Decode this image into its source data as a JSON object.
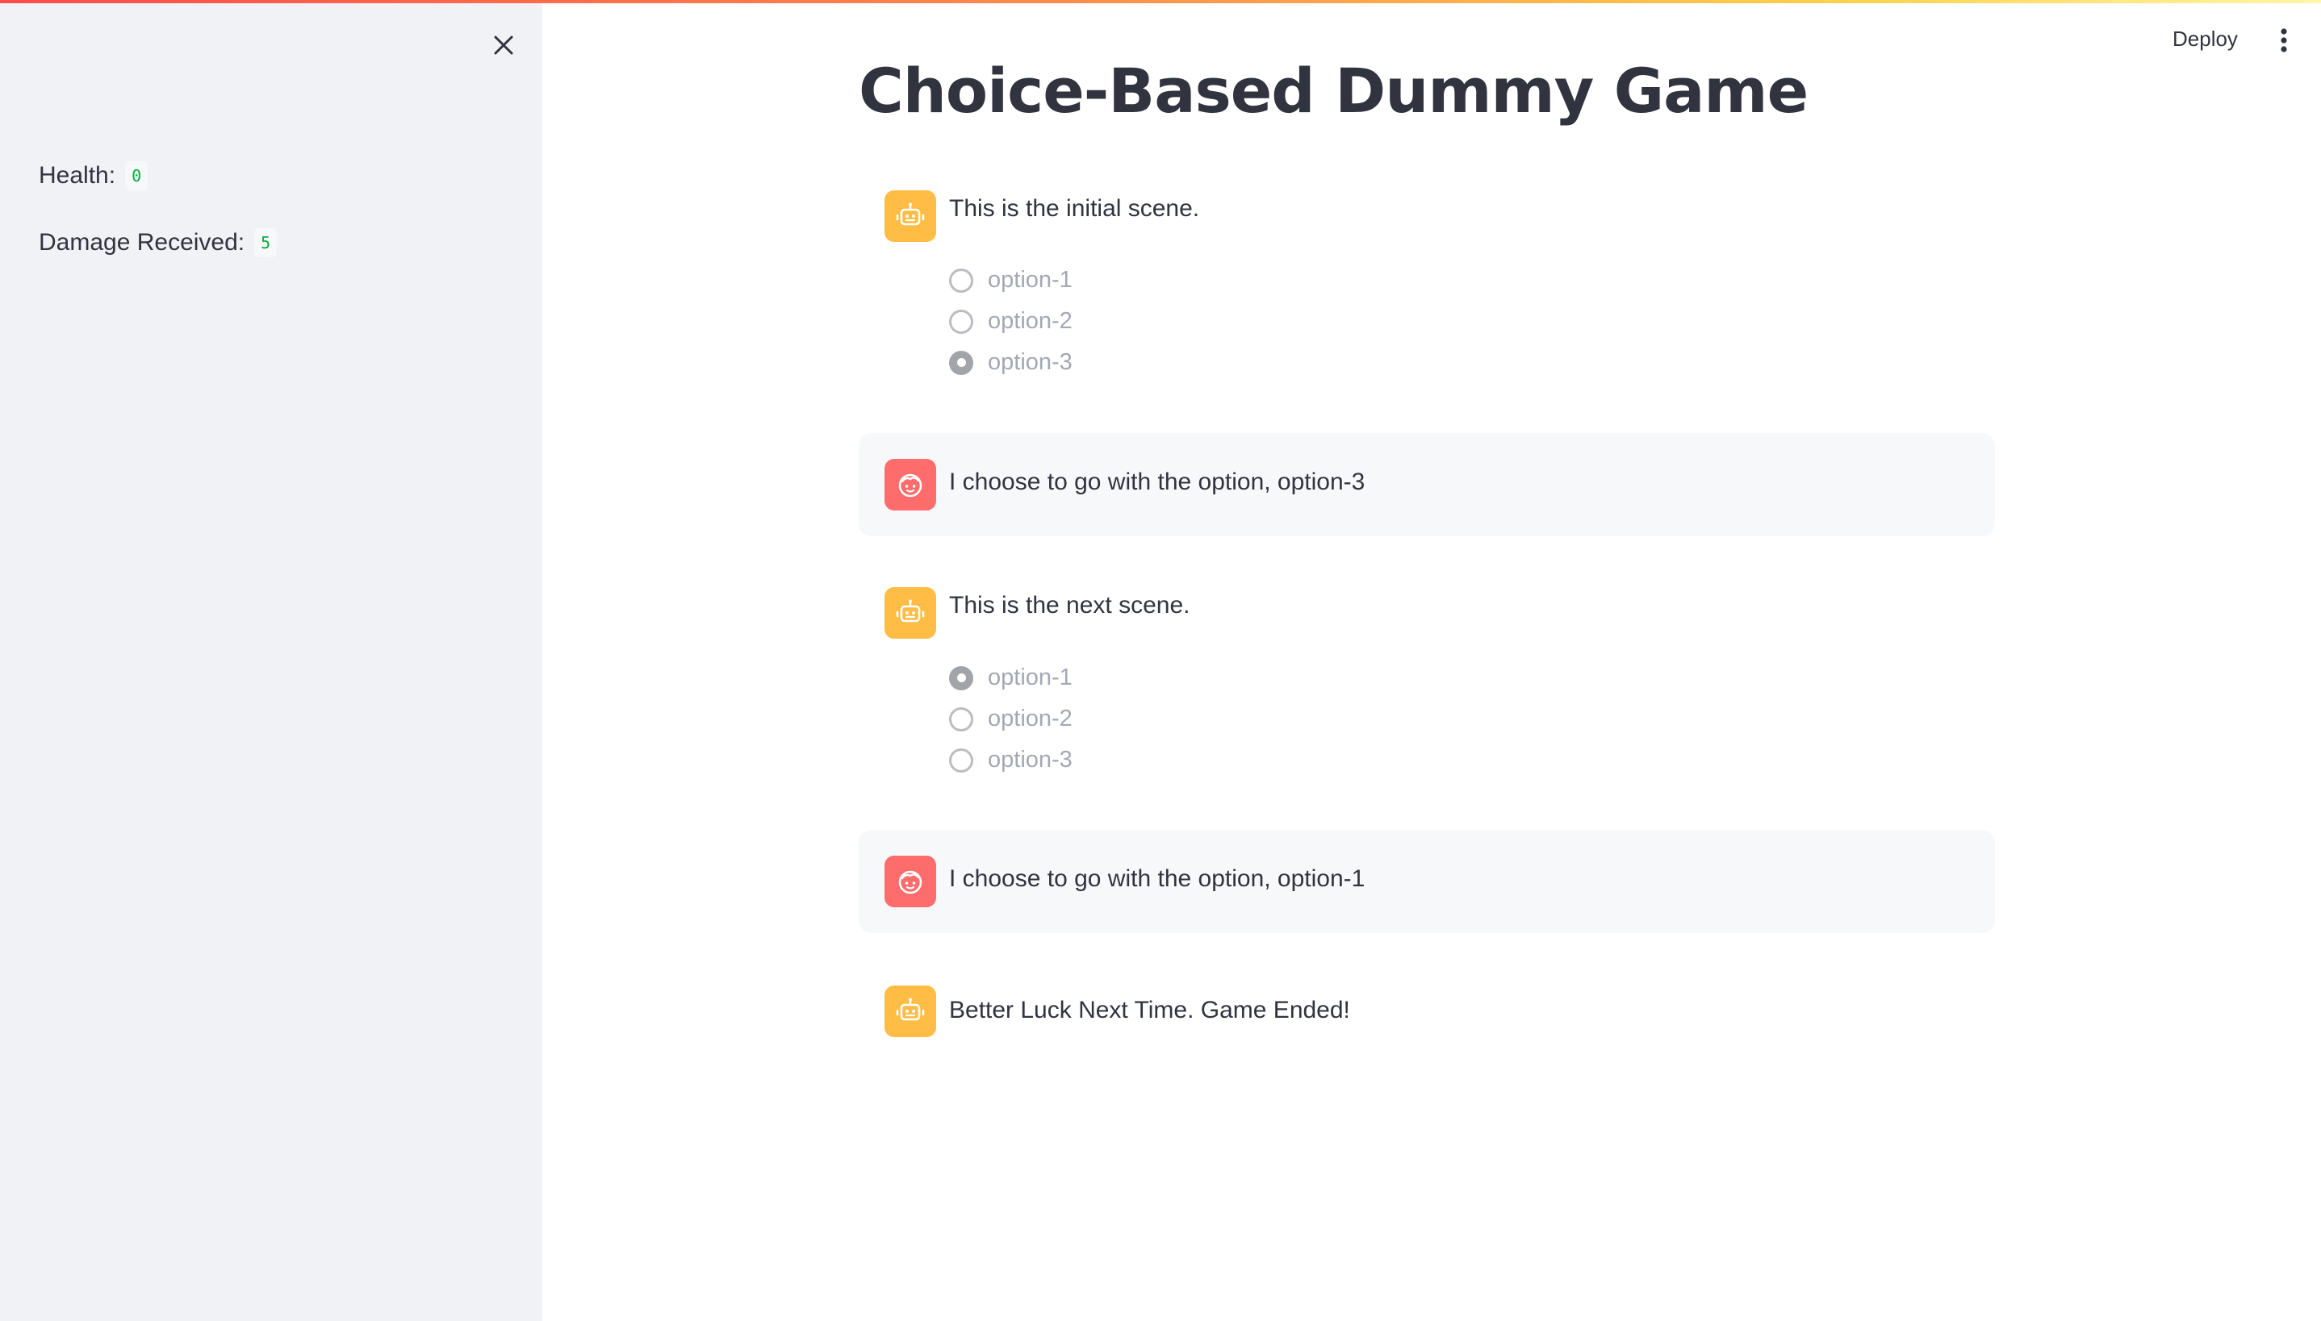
{
  "header": {
    "deploy_label": "Deploy"
  },
  "sidebar": {
    "metrics": [
      {
        "label": "Health:",
        "value": "0"
      },
      {
        "label": "Damage Received:",
        "value": "5"
      }
    ]
  },
  "main": {
    "title": "Choice-Based Dummy Game",
    "messages": [
      {
        "role": "assistant",
        "text": "This is the initial scene.",
        "options": [
          "option-1",
          "option-2",
          "option-3"
        ],
        "selected": "option-3"
      },
      {
        "role": "user",
        "text": "I choose to go with the option, option-3"
      },
      {
        "role": "assistant",
        "text": "This is the next scene.",
        "options": [
          "option-1",
          "option-2",
          "option-3"
        ],
        "selected": "option-1"
      },
      {
        "role": "user",
        "text": "I choose to go with the option, option-1"
      },
      {
        "role": "assistant",
        "text": "Better Luck Next Time. Game Ended!"
      }
    ]
  },
  "colors": {
    "sidebar_bg": "#f0f2f6",
    "assistant_avatar": "#ffbd45",
    "user_avatar": "#ff6c6c",
    "code_green": "#09ab3b",
    "text": "#31333f"
  },
  "icons": {
    "close": "close-icon",
    "menu": "kebab-menu-icon",
    "assistant": "bot-avatar-icon",
    "user": "user-avatar-icon"
  }
}
